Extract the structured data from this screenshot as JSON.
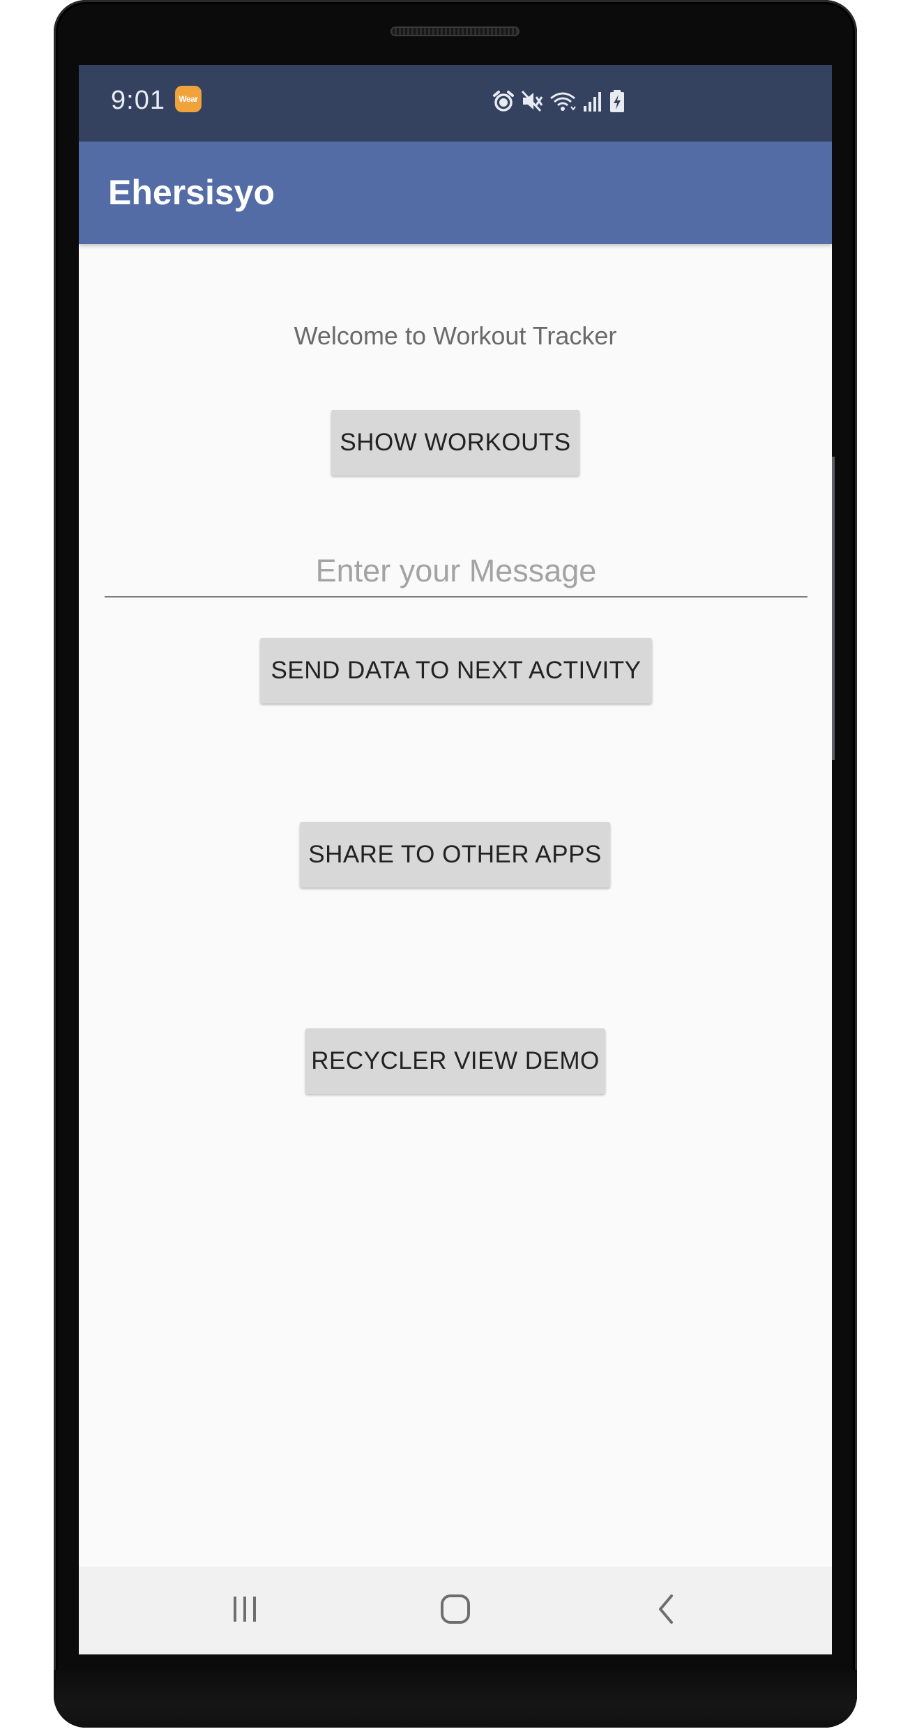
{
  "status_bar": {
    "time": "9:01",
    "wear_badge": "Wear",
    "icons": [
      "alarm-icon",
      "mute-icon",
      "wifi-icon",
      "signal-icon",
      "battery-charging-icon"
    ]
  },
  "app_bar": {
    "title": "Ehersisyo"
  },
  "main": {
    "welcome_text": "Welcome to Workout Tracker",
    "show_workouts_label": "SHOW WORKOUTS",
    "message_input": {
      "value": "",
      "placeholder": "Enter your Message"
    },
    "send_data_label": "SEND DATA TO NEXT ACTIVITY",
    "share_label": "SHARE TO OTHER APPS",
    "recycler_label": "RECYCLER VIEW DEMO"
  },
  "nav_bar": {
    "icons": [
      "recents-icon",
      "home-icon",
      "back-icon"
    ]
  },
  "colors": {
    "status_bar": "#34425f",
    "app_bar": "#536ca6",
    "background": "#fafafa",
    "button": "#d7d8d7",
    "wear_badge": "#f0a23b"
  }
}
